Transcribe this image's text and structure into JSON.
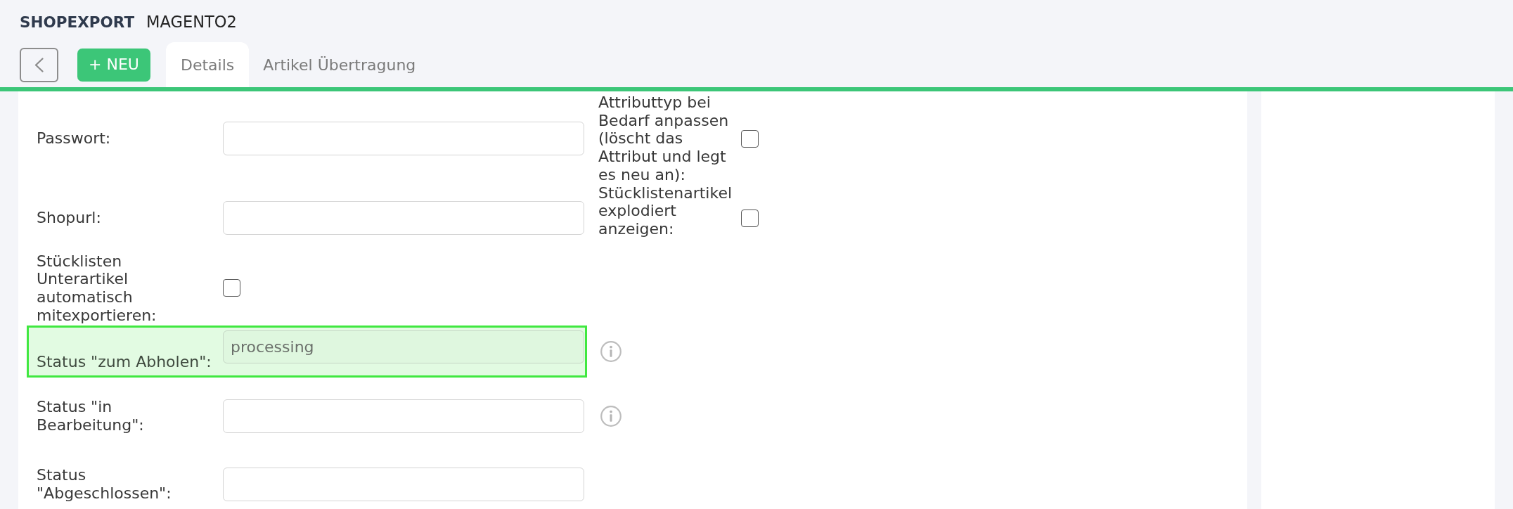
{
  "header": {
    "title": "SHOPEXPORT",
    "subtitle": "MAGENTO2"
  },
  "toolbar": {
    "new_button": "+ NEU"
  },
  "tabs": [
    {
      "label": "Details",
      "selected": true
    },
    {
      "label": "Artikel Übertragung",
      "selected": false
    }
  ],
  "form_rows": [
    {
      "left": {
        "kind": "text",
        "label": "Passwort:",
        "highlighted": false,
        "info": false
      },
      "right": {
        "kind": "checkbox",
        "label": "Attributtyp bei Bedarf anpassen (löscht das Attribut und legt es neu an):",
        "checked": false
      }
    },
    {
      "left": {
        "kind": "text",
        "label": "Shopurl:",
        "highlighted": false,
        "info": false
      },
      "right": {
        "kind": "checkbox",
        "label": "Stücklistenartikel explodiert anzeigen:",
        "checked": false
      }
    },
    {
      "left": {
        "kind": "checkbox",
        "label": "Stücklisten Unterartikel automatisch mitexportieren:",
        "highlighted": false,
        "checked": false
      }
    },
    {
      "left": {
        "kind": "text",
        "label": "Status \"zum Abholen\":",
        "placeholder": "processing",
        "highlighted": true,
        "info": true
      }
    },
    {
      "left": {
        "kind": "text",
        "label": "Status \"in Bearbeitung\":",
        "highlighted": false,
        "info": true
      }
    },
    {
      "left": {
        "kind": "text",
        "label": "Status \"Abgeschlossen\":",
        "highlighted": false,
        "info": false
      }
    }
  ]
}
